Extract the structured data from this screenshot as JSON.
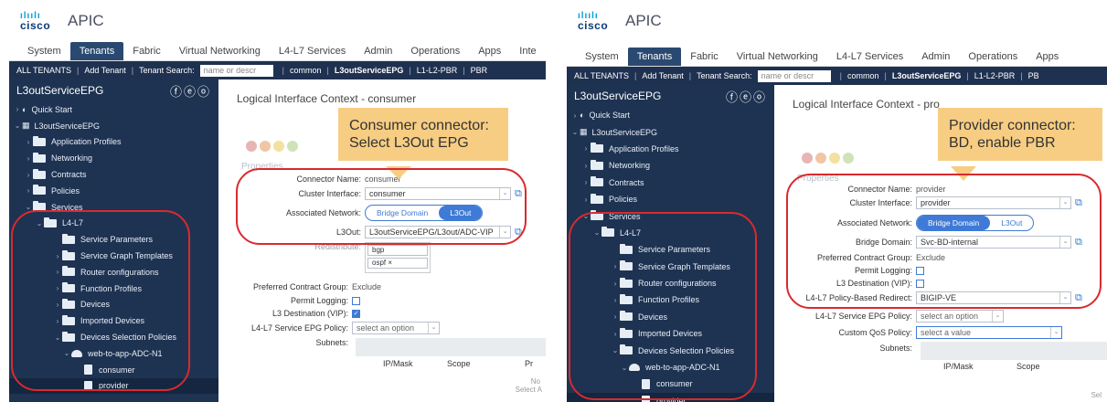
{
  "left": {
    "app_title": "APIC",
    "logo_text": "cisco",
    "tabs": [
      "System",
      "Tenants",
      "Fabric",
      "Virtual Networking",
      "L4-L7 Services",
      "Admin",
      "Operations",
      "Apps",
      "Inte"
    ],
    "subnav": {
      "all_tenants": "ALL TENANTS",
      "add_tenant": "Add Tenant",
      "tenant_search": "Tenant Search:",
      "search_placeholder": "name or descr",
      "common": "common",
      "current": "L3outServiceEPG",
      "l1": "L1-L2-PBR",
      "pbr": "PBR"
    },
    "tenant_name": "L3outServiceEPG",
    "tree": {
      "quick_start": "Quick Start",
      "tenant": "L3outServiceEPG",
      "application_profiles": "Application Profiles",
      "networking": "Networking",
      "contracts": "Contracts",
      "policies": "Policies",
      "services": "Services",
      "l4l7": "L4-L7",
      "service_parameters": "Service Parameters",
      "service_graph_templates": "Service Graph Templates",
      "router_configurations": "Router configurations",
      "function_profiles": "Function Profiles",
      "devices": "Devices",
      "imported_devices": "Imported Devices",
      "devices_selection_policies": "Devices Selection Policies",
      "web_to_app": "web-to-app-ADC-N1",
      "consumer": "consumer",
      "provider": "provider"
    },
    "main": {
      "title": "Logical Interface Context - consumer",
      "properties": "Properties",
      "connector_name_label": "Connector Name:",
      "connector_name_value": "consumer",
      "cluster_interface_label": "Cluster Interface:",
      "cluster_interface_value": "consumer",
      "associated_network_label": "Associated Network:",
      "bridge_domain": "Bridge Domain",
      "l3out": "L3Out",
      "l3out_label": "L3Out:",
      "l3out_value": "L3outServiceEPG/L3out/ADC-VIP",
      "redistribute_label": "Redistribute:",
      "redistribute_tags": [
        "bgp",
        "ospf ×"
      ],
      "preferred_group_label": "Preferred Contract Group:",
      "preferred_group_value": "Exclude",
      "permit_logging_label": "Permit Logging:",
      "l3_destination_label": "L3 Destination (VIP):",
      "service_epg_policy_label": "L4-L7 Service EPG Policy:",
      "service_epg_policy_value": "select an option",
      "subnets_label": "Subnets:",
      "col_ip": "IP/Mask",
      "col_scope": "Scope",
      "col_pr": "Pr",
      "faint_no": "No",
      "faint_select": "Select A"
    },
    "callout": "Consumer connector: Select  L3Out EPG"
  },
  "right": {
    "app_title": "APIC",
    "logo_text": "cisco",
    "tabs": [
      "System",
      "Tenants",
      "Fabric",
      "Virtual Networking",
      "L4-L7 Services",
      "Admin",
      "Operations",
      "Apps"
    ],
    "subnav": {
      "all_tenants": "ALL TENANTS",
      "add_tenant": "Add Tenant",
      "tenant_search": "Tenant Search:",
      "search_placeholder": "name or descr",
      "common": "common",
      "current": "L3outServiceEPG",
      "l1": "L1-L2-PBR",
      "pbr": "PB"
    },
    "tenant_name": "L3outServiceEPG",
    "tree": {
      "quick_start": "Quick Start",
      "tenant": "L3outServiceEPG",
      "application_profiles": "Application Profiles",
      "networking": "Networking",
      "contracts": "Contracts",
      "policies": "Policies",
      "services": "Services",
      "l4l7": "L4-L7",
      "service_parameters": "Service Parameters",
      "service_graph_templates": "Service Graph Templates",
      "router_configurations": "Router configurations",
      "function_profiles": "Function Profiles",
      "devices": "Devices",
      "imported_devices": "Imported Devices",
      "devices_selection_policies": "Devices Selection Policies",
      "web_to_app": "web-to-app-ADC-N1",
      "consumer": "consumer",
      "provider": "provider"
    },
    "main": {
      "title": "Logical Interface Context - pro",
      "properties": "Properties",
      "connector_name_label": "Connector Name:",
      "connector_name_value": "provider",
      "cluster_interface_label": "Cluster Interface:",
      "cluster_interface_value": "provider",
      "associated_network_label": "Associated Network:",
      "bridge_domain": "Bridge Domain",
      "l3out": "L3Out",
      "bridge_domain_label": "Bridge Domain:",
      "bridge_domain_value": "Svc-BD-internal",
      "preferred_group_label": "Preferred Contract Group:",
      "preferred_group_value": "Exclude",
      "permit_logging_label": "Permit Logging:",
      "l3_destination_label": "L3 Destination (VIP):",
      "pbr_label": "L4-L7 Policy-Based Redirect:",
      "pbr_value": "BIGIP-VE",
      "service_epg_policy_label": "L4-L7 Service EPG Policy:",
      "service_epg_policy_value": "select an option",
      "qos_label": "Custom QoS Policy:",
      "qos_value": "select a value",
      "subnets_label": "Subnets:",
      "col_ip": "IP/Mask",
      "col_scope": "Scope",
      "faint_sel": "Sel"
    },
    "callout": "Provider connector: BD, enable PBR"
  },
  "colors": {
    "nav_bg": "#1e3352",
    "subnav_bg": "#1f3150",
    "accent": "#3f7ad6",
    "highlight_oval": "#d92a2e",
    "callout_bg": "#f7cd83"
  }
}
